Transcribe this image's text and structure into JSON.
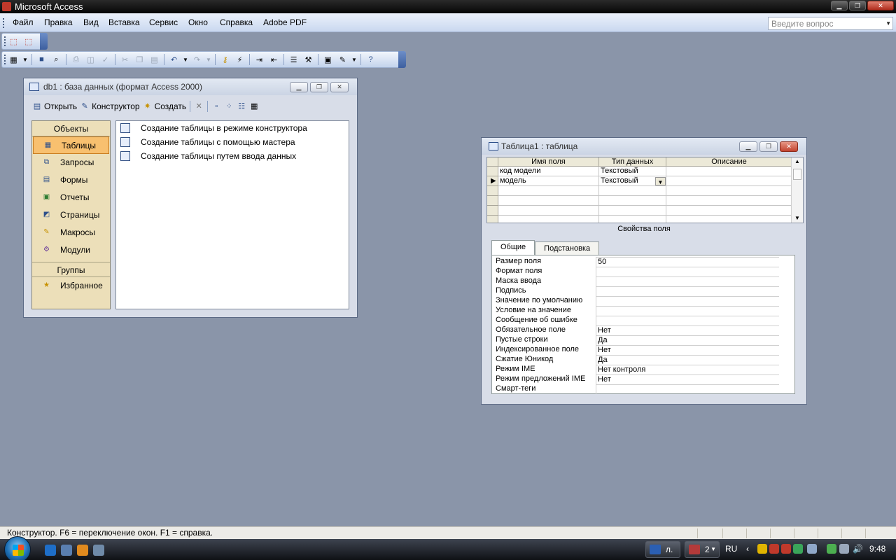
{
  "app": {
    "title": "Microsoft Access"
  },
  "menubar": {
    "items": [
      "Файл",
      "Правка",
      "Вид",
      "Вставка",
      "Сервис",
      "Окно",
      "Справка",
      "Adobe PDF"
    ],
    "help_placeholder": "Введите вопрос"
  },
  "db_window": {
    "title": "db1 : база данных (формат Access 2000)",
    "toolbar": {
      "open": "Открыть",
      "design": "Конструктор",
      "create": "Создать"
    },
    "objects_header": "Объекты",
    "objects": [
      {
        "label": "Таблицы",
        "icon": "table-icon",
        "selected": true
      },
      {
        "label": "Запросы",
        "icon": "query-icon"
      },
      {
        "label": "Формы",
        "icon": "form-icon"
      },
      {
        "label": "Отчеты",
        "icon": "report-icon"
      },
      {
        "label": "Страницы",
        "icon": "page-icon"
      },
      {
        "label": "Макросы",
        "icon": "macro-icon"
      },
      {
        "label": "Модули",
        "icon": "module-icon"
      }
    ],
    "groups_header": "Группы",
    "groups": [
      {
        "label": "Избранное",
        "icon": "favorites-icon"
      }
    ],
    "list_items": [
      "Создание таблицы в режиме конструктора",
      "Создание таблицы с помощью мастера",
      "Создание таблицы путем ввода данных"
    ]
  },
  "table_window": {
    "title": "Таблица1 : таблица",
    "columns": [
      "Имя поля",
      "Тип данных",
      "Описание"
    ],
    "rows": [
      {
        "name": "код модели",
        "type": "Текстовый",
        "description": ""
      },
      {
        "name": "модель",
        "type": "Текстовый",
        "description": "",
        "current": true
      }
    ],
    "properties_label": "Свойства поля",
    "tabs": [
      "Общие",
      "Подстановка"
    ],
    "active_tab": "Общие",
    "properties": [
      {
        "name": "Размер поля",
        "value": "50"
      },
      {
        "name": "Формат поля",
        "value": ""
      },
      {
        "name": "Маска ввода",
        "value": ""
      },
      {
        "name": "Подпись",
        "value": ""
      },
      {
        "name": "Значение по умолчанию",
        "value": ""
      },
      {
        "name": "Условие на значение",
        "value": ""
      },
      {
        "name": "Сообщение об ошибке",
        "value": ""
      },
      {
        "name": "Обязательное поле",
        "value": "Нет"
      },
      {
        "name": "Пустые строки",
        "value": "Да"
      },
      {
        "name": "Индексированное поле",
        "value": "Нет"
      },
      {
        "name": "Сжатие Юникод",
        "value": "Да"
      },
      {
        "name": "Режим IME",
        "value": "Нет контроля"
      },
      {
        "name": "Режим предложений IME",
        "value": "Нет"
      },
      {
        "name": "Смарт-теги",
        "value": ""
      }
    ]
  },
  "statusbar": {
    "text": "Конструктор.  F6 = переключение окон.  F1 = справка."
  },
  "taskbar": {
    "buttons": [
      {
        "label": "л."
      },
      {
        "label": "2"
      }
    ],
    "language": "RU",
    "clock": "9:48"
  },
  "colors": {
    "desktop_bg": "#8a95a9",
    "selected_object": "#f8c06f",
    "objects_bar": "#ecdfb9"
  }
}
